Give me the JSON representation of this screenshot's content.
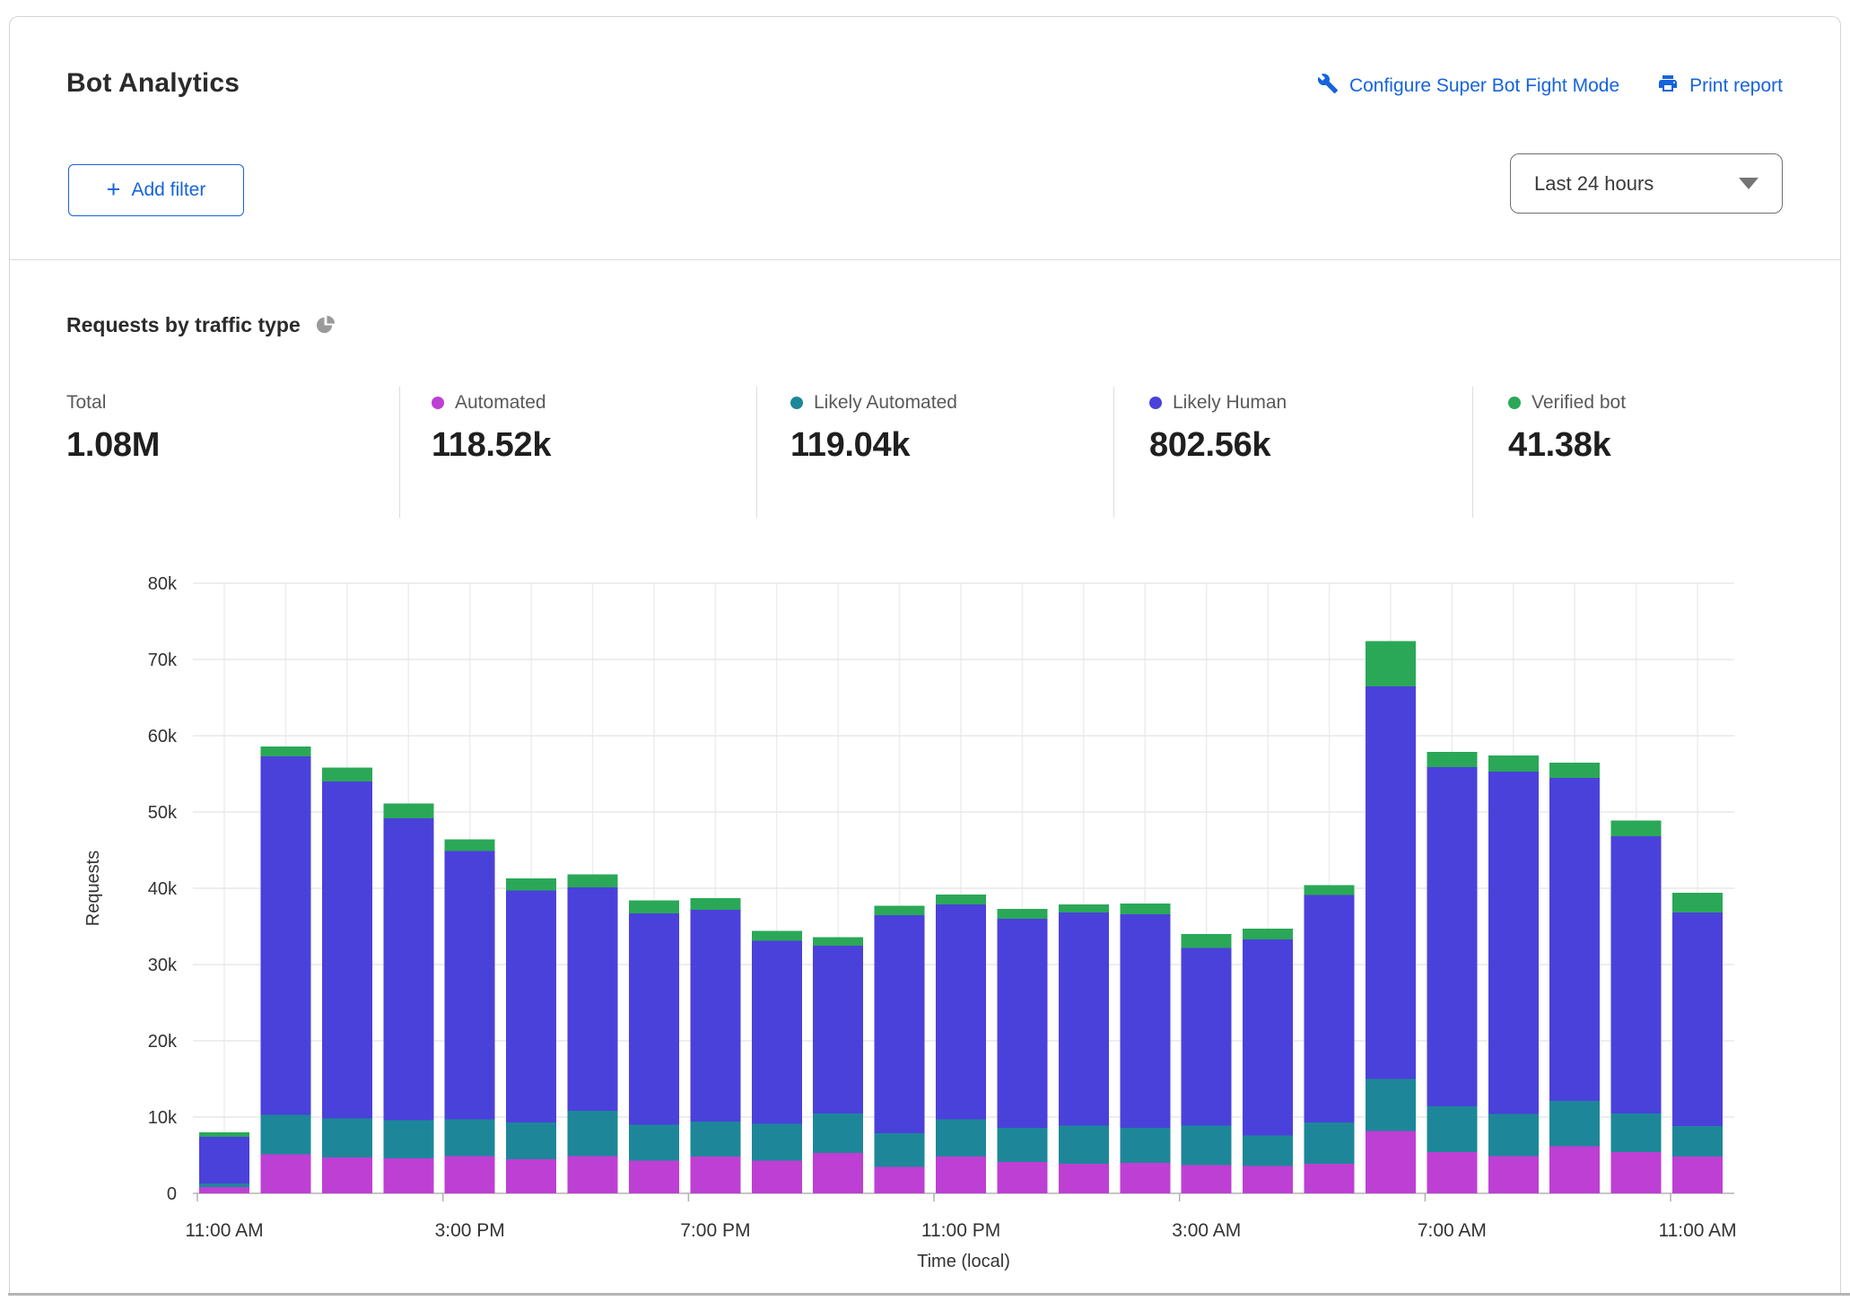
{
  "header": {
    "title": "Bot Analytics",
    "configure_link": "Configure Super Bot Fight Mode",
    "print_link": "Print report",
    "add_filter_label": "Add filter",
    "add_filter_plus": "+",
    "time_range_value": "Last 24 hours"
  },
  "section": {
    "title": "Requests by traffic type"
  },
  "stats": [
    {
      "label": "Total",
      "value": "1.08M",
      "color": null
    },
    {
      "label": "Automated",
      "value": "118.52k",
      "color": "#be3fd4"
    },
    {
      "label": "Likely Automated",
      "value": "119.04k",
      "color": "#1d8799"
    },
    {
      "label": "Likely Human",
      "value": "802.56k",
      "color": "#4a41db"
    },
    {
      "label": "Verified bot",
      "value": "41.38k",
      "color": "#2aa857"
    }
  ],
  "colors": {
    "link_blue": "#1663dc",
    "card_border": "#d4d4d4",
    "grid_line": "#e8e8e8",
    "axis_line": "#c6c6c6"
  },
  "chart_data": {
    "type": "bar",
    "stacked": true,
    "title": "Requests by traffic type",
    "xlabel": "Time (local)",
    "ylabel": "Requests",
    "ylim": [
      0,
      80000
    ],
    "grid": true,
    "y_ticks": [
      "0",
      "10k",
      "20k",
      "30k",
      "40k",
      "50k",
      "60k",
      "70k",
      "80k"
    ],
    "categories": [
      "11:00 AM",
      "12:00 PM",
      "1:00 PM",
      "2:00 PM",
      "3:00 PM",
      "4:00 PM",
      "5:00 PM",
      "6:00 PM",
      "7:00 PM",
      "8:00 PM",
      "9:00 PM",
      "10:00 PM",
      "11:00 PM",
      "12:00 AM",
      "1:00 AM",
      "2:00 AM",
      "3:00 AM",
      "4:00 AM",
      "5:00 AM",
      "6:00 AM",
      "7:00 AM",
      "8:00 AM",
      "9:00 AM",
      "10:00 AM",
      "11:00 AM"
    ],
    "x_tick_indices": [
      0,
      4,
      8,
      12,
      16,
      20,
      24
    ],
    "x_tick_labels": [
      "11:00 AM",
      "3:00 PM",
      "7:00 PM",
      "11:00 PM",
      "3:00 AM",
      "7:00 AM",
      "11:00 AM"
    ],
    "series": [
      {
        "name": "Automated",
        "color": "#be3fd4",
        "values": [
          800,
          5100,
          4700,
          4600,
          4900,
          4500,
          4900,
          4300,
          4800,
          4300,
          5300,
          3500,
          4800,
          4100,
          3900,
          4000,
          3700,
          3600,
          3900,
          8200,
          5400,
          4900,
          6200,
          5400,
          4800
        ]
      },
      {
        "name": "Likely Automated",
        "color": "#1d8799",
        "values": [
          500,
          5200,
          5100,
          5000,
          4800,
          4800,
          5900,
          4700,
          4600,
          4800,
          5200,
          4400,
          4900,
          4500,
          5000,
          4600,
          5200,
          4000,
          5400,
          6800,
          6000,
          5500,
          5900,
          5100,
          4000
        ]
      },
      {
        "name": "Likely Human",
        "color": "#4a41db",
        "values": [
          6100,
          47000,
          44200,
          39600,
          35200,
          30400,
          29300,
          27700,
          27800,
          24000,
          22000,
          28600,
          28200,
          27400,
          27900,
          28000,
          23300,
          25700,
          29800,
          51500,
          44500,
          44900,
          42400,
          36300,
          28000
        ]
      },
      {
        "name": "Verified bot",
        "color": "#2aa857",
        "values": [
          600,
          1300,
          1800,
          1900,
          1500,
          1600,
          1700,
          1700,
          1500,
          1300,
          1100,
          1200,
          1300,
          1300,
          1100,
          1400,
          1800,
          1400,
          1300,
          5900,
          2000,
          2100,
          2000,
          2100,
          2600
        ]
      }
    ],
    "legend_position": "top"
  }
}
